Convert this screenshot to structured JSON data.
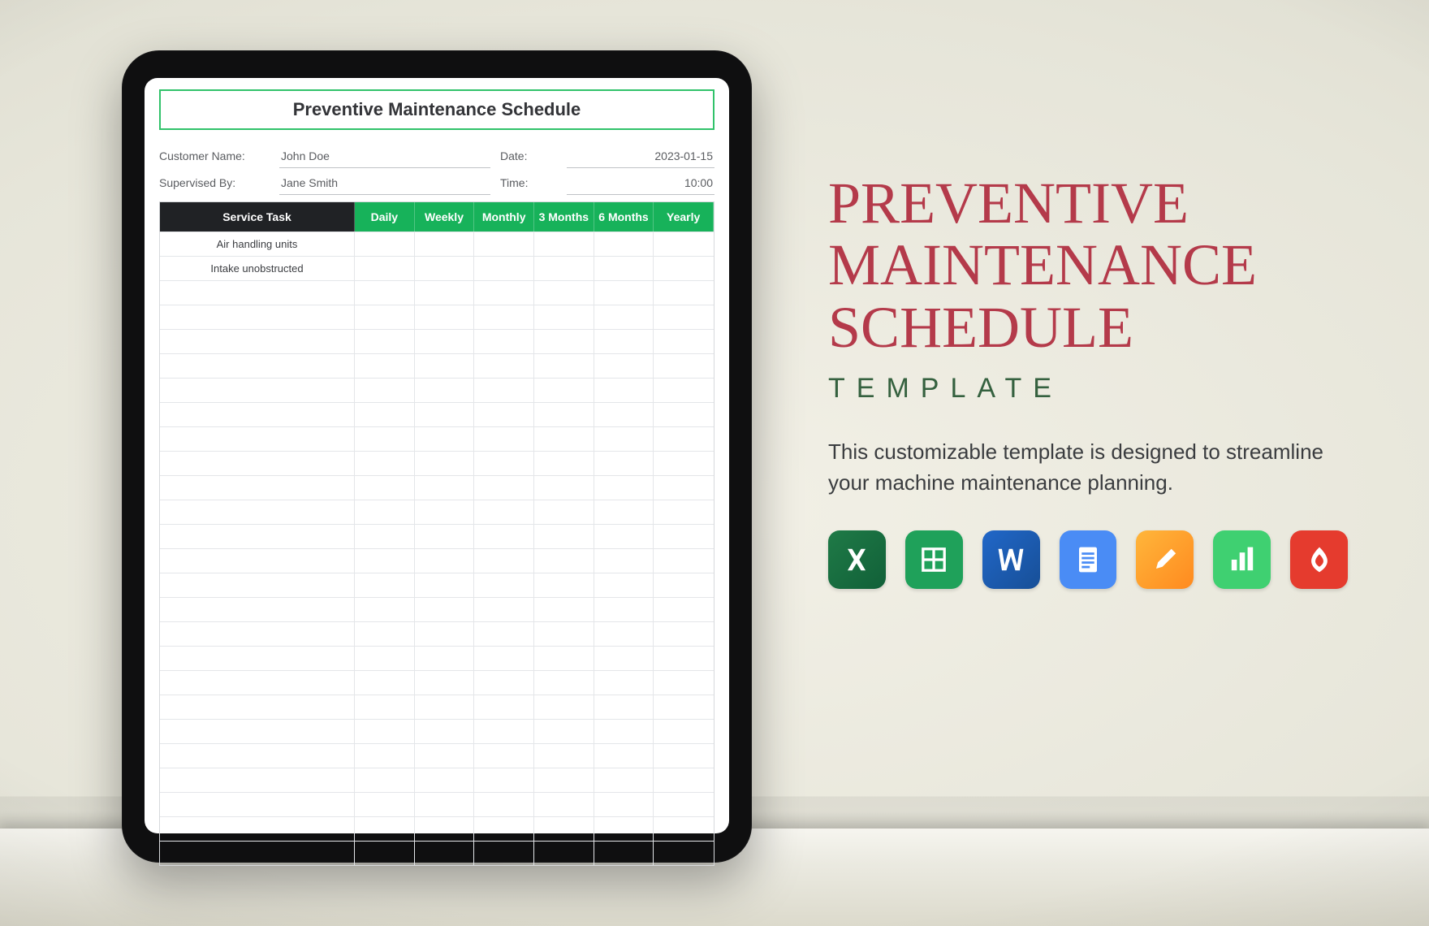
{
  "tablet": {
    "title": "Preventive Maintenance Schedule",
    "meta": {
      "customer_label": "Customer Name:",
      "customer_value": "John Doe",
      "supervisor_label": "Supervised By:",
      "supervisor_value": "Jane Smith",
      "date_label": "Date:",
      "date_value": "2023-01-15",
      "time_label": "Time:",
      "time_value": "10:00"
    },
    "columns": [
      "Service Task",
      "Daily",
      "Weekly",
      "Monthly",
      "3 Months",
      "6 Months",
      "Yearly"
    ],
    "rows": [
      {
        "task": "Air handling units"
      },
      {
        "task": "Intake unobstructed"
      }
    ],
    "blank_row_count": 24
  },
  "side": {
    "title_line1": "Preventive",
    "title_line2": "Maintenance",
    "title_line3": "Schedule",
    "template_label": "TEMPLATE",
    "description": "This customizable template is designed to streamline your machine maintenance planning."
  },
  "apps": [
    {
      "name": "excel",
      "label": "Excel"
    },
    {
      "name": "sheets",
      "label": "Google Sheets"
    },
    {
      "name": "word",
      "label": "Word"
    },
    {
      "name": "docs",
      "label": "Google Docs"
    },
    {
      "name": "pages",
      "label": "Pages"
    },
    {
      "name": "numbers",
      "label": "Numbers"
    },
    {
      "name": "pdf",
      "label": "PDF"
    }
  ]
}
